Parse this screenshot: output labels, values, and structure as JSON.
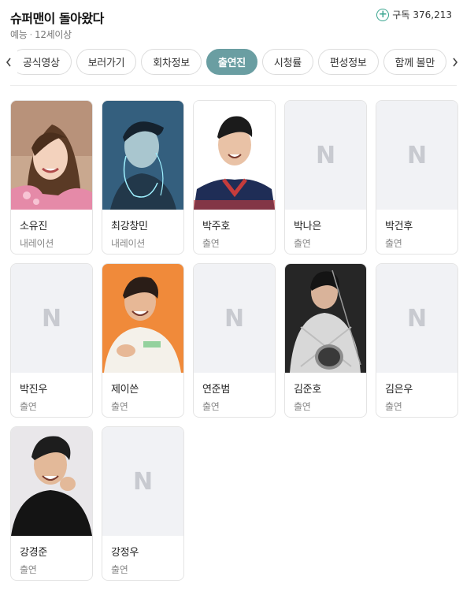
{
  "header": {
    "title": "슈퍼맨이 돌아왔다",
    "genre": "예능",
    "rating": "12세이상",
    "subscribe_label": "구독",
    "subscribe_count": "376,213"
  },
  "tabs": [
    {
      "label": "공식영상",
      "active": false
    },
    {
      "label": "보러가기",
      "active": false
    },
    {
      "label": "회차정보",
      "active": false
    },
    {
      "label": "출연진",
      "active": true
    },
    {
      "label": "시청률",
      "active": false
    },
    {
      "label": "편성정보",
      "active": false
    },
    {
      "label": "함께 볼만",
      "active": false
    }
  ],
  "placeholder_letter": "N",
  "cast": [
    {
      "name": "소유진",
      "role": "내레이션",
      "photo": "person"
    },
    {
      "name": "최강창민",
      "role": "내레이션",
      "photo": "person"
    },
    {
      "name": "박주호",
      "role": "출연",
      "photo": "person"
    },
    {
      "name": "박나은",
      "role": "출연",
      "photo": "placeholder"
    },
    {
      "name": "박건후",
      "role": "출연",
      "photo": "placeholder"
    },
    {
      "name": "박진우",
      "role": "출연",
      "photo": "placeholder"
    },
    {
      "name": "제이쓴",
      "role": "출연",
      "photo": "person"
    },
    {
      "name": "연준범",
      "role": "출연",
      "photo": "placeholder"
    },
    {
      "name": "김준호",
      "role": "출연",
      "photo": "person"
    },
    {
      "name": "김은우",
      "role": "출연",
      "photo": "placeholder"
    },
    {
      "name": "강경준",
      "role": "출연",
      "photo": "person"
    },
    {
      "name": "강정우",
      "role": "출연",
      "photo": "placeholder"
    }
  ],
  "colors": {
    "active_tab": "#6a9ea2",
    "subscribe_icon": "#3aa58f",
    "placeholder_bg": "#f1f2f5"
  }
}
